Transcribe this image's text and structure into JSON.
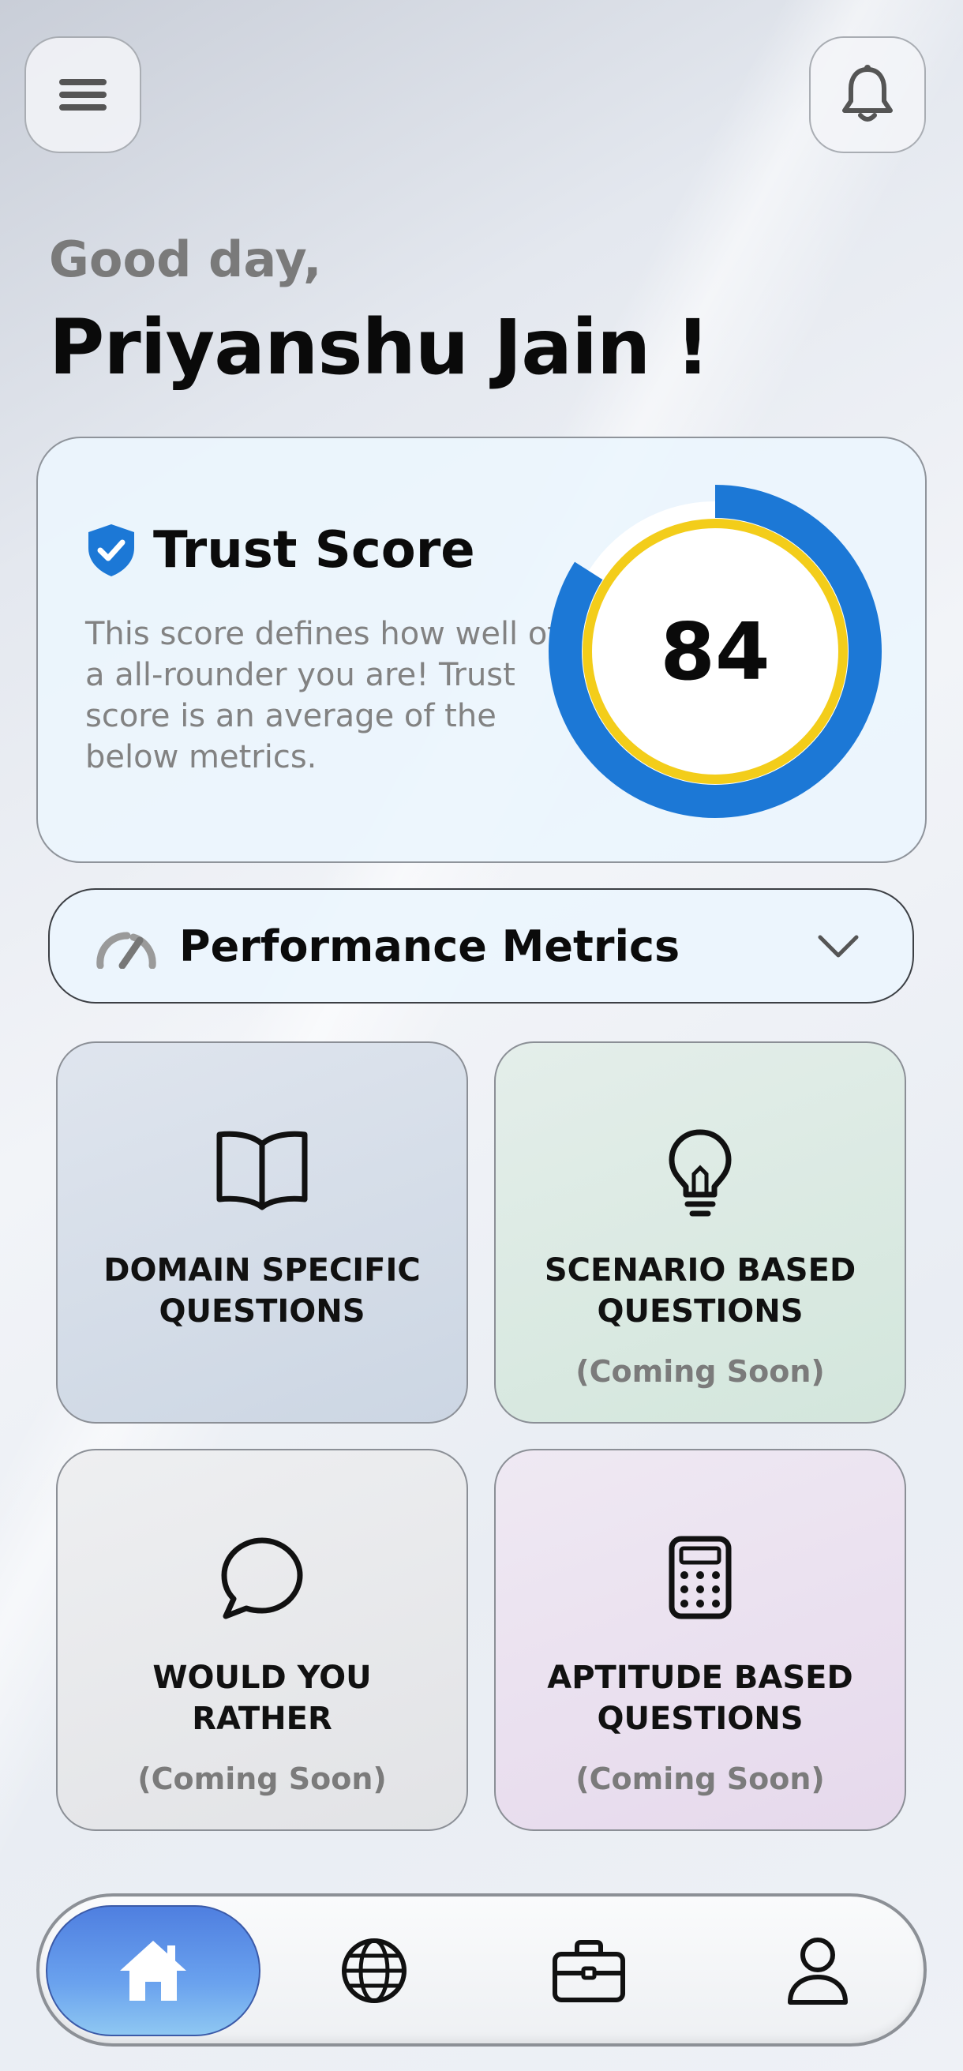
{
  "header": {
    "menu_icon": "hamburger-menu-icon",
    "notification_icon": "bell-icon",
    "greeting": "Good day,",
    "user_name": "Priyanshu Jain !"
  },
  "trust_score": {
    "title": "Trust Score",
    "icon": "verified-shield-icon",
    "description": "This score defines how well of a all-rounder you are! Trust score is an average of the below metrics.",
    "value": "84",
    "value_fraction": 0.84,
    "colors": {
      "ring": "#1c78d6",
      "inner_ring": "#f3cd1a",
      "track": "#ffffff"
    }
  },
  "performance": {
    "label": "Performance Metrics",
    "icon": "speedometer-icon",
    "toggle_icon": "chevron-down-icon"
  },
  "tiles": [
    {
      "label": "DOMAIN SPECIFIC\nQUESTIONS",
      "status": "",
      "icon": "open-book-icon"
    },
    {
      "label": "SCENARIO BASED\nQUESTIONS",
      "status": "(Coming Soon)",
      "icon": "lightbulb-icon"
    },
    {
      "label": "WOULD YOU\nRATHER",
      "status": "(Coming Soon)",
      "icon": "speech-bubble-icon"
    },
    {
      "label": "APTITUDE BASED\nQUESTIONS",
      "status": "(Coming Soon)",
      "icon": "calculator-icon"
    }
  ],
  "bottom_nav": {
    "items": [
      "home-icon",
      "globe-icon",
      "briefcase-icon",
      "profile-icon"
    ],
    "active": "home-icon"
  }
}
